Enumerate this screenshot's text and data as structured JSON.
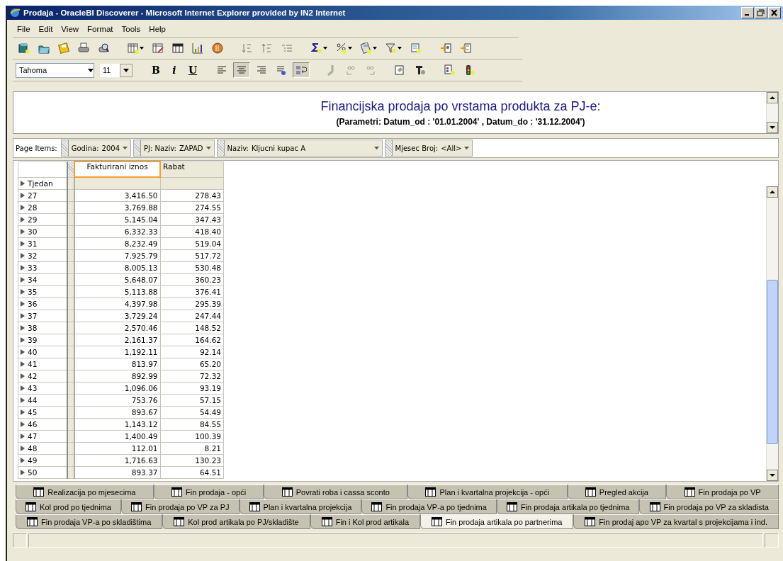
{
  "window": {
    "title": "Prodaja - OracleBI Discoverer - Microsoft Internet Explorer provided by IN2 Internet"
  },
  "menu": [
    "File",
    "Edit",
    "View",
    "Format",
    "Tools",
    "Help"
  ],
  "toolbar": [
    {
      "kind": "workbook",
      "dropdown": false
    },
    {
      "kind": "open",
      "dropdown": false
    },
    {
      "kind": "save",
      "dropdown": false
    },
    {
      "kind": "print",
      "dropdown": false
    },
    {
      "kind": "preview",
      "dropdown": false
    },
    {
      "kind": "newsheet",
      "dropdown": true
    },
    {
      "kind": "editsheet",
      "dropdown": false
    },
    {
      "kind": "table",
      "dropdown": false
    },
    {
      "kind": "chart",
      "dropdown": false
    },
    {
      "kind": "stop",
      "dropdown": false
    },
    {
      "kind": "sortup",
      "dropdown": false
    },
    {
      "kind": "sortdown",
      "dropdown": false
    },
    {
      "kind": "outline",
      "dropdown": false
    },
    {
      "kind": "sum",
      "dropdown": true
    },
    {
      "kind": "percent",
      "dropdown": true
    },
    {
      "kind": "calculate",
      "dropdown": true
    },
    {
      "kind": "filter",
      "dropdown": true
    },
    {
      "kind": "parameter",
      "dropdown": false
    },
    {
      "kind": "import",
      "dropdown": false
    },
    {
      "kind": "export",
      "dropdown": false
    }
  ],
  "format_bar": {
    "font": "Tahoma",
    "size": "11",
    "styles": [
      {
        "kind": "bold",
        "label": "B"
      },
      {
        "kind": "italic",
        "label": "i"
      },
      {
        "kind": "underline",
        "label": "U"
      }
    ],
    "buttons": [
      {
        "kind": "alignleft",
        "selected": false
      },
      {
        "kind": "aligncenter",
        "selected": true
      },
      {
        "kind": "alignright",
        "selected": false
      },
      {
        "kind": "fill",
        "selected": false
      },
      {
        "kind": "wrap",
        "selected": true
      },
      {
        "kind": "comma",
        "selected": false
      },
      {
        "kind": "decimalmore",
        "selected": false
      },
      {
        "kind": "decimalless",
        "selected": false
      },
      {
        "kind": "format",
        "selected": false
      },
      {
        "kind": "textformat",
        "selected": false
      },
      {
        "kind": "conditional",
        "selected": false
      },
      {
        "kind": "stoplight",
        "selected": false
      }
    ]
  },
  "report": {
    "title": "Financijska prodaja po vrstama produkta za PJ-e:",
    "subtitle": "(Parametri: Datum_od : '01.01.2004' , Datum_do : '31.12.2004')"
  },
  "page_items": {
    "label": "Page Items:",
    "items": [
      {
        "label": "Godina:",
        "value": "2004"
      },
      {
        "label": "PJ: Naziv:",
        "value": "ZAPAD"
      },
      {
        "label": "Naziv:",
        "value": "Kljucni kupac A"
      },
      {
        "label": "Mjesec Broj:",
        "value": "<All>"
      }
    ]
  },
  "table": {
    "columns": [
      {
        "label": "Fakturirani iznos",
        "selected": true
      },
      {
        "label": "Rabat",
        "selected": false
      }
    ],
    "row_header": "Tjedan",
    "rows": [
      {
        "week": "27",
        "values": [
          "3,416.50",
          "278.43"
        ]
      },
      {
        "week": "28",
        "values": [
          "3,769.88",
          "274.55"
        ]
      },
      {
        "week": "29",
        "values": [
          "5,145.04",
          "347.43"
        ]
      },
      {
        "week": "30",
        "values": [
          "6,332.33",
          "418.40"
        ]
      },
      {
        "week": "31",
        "values": [
          "8,232.49",
          "519.04"
        ]
      },
      {
        "week": "32",
        "values": [
          "7,925.79",
          "517.72"
        ]
      },
      {
        "week": "33",
        "values": [
          "8,005.13",
          "530.48"
        ]
      },
      {
        "week": "34",
        "values": [
          "5,648.07",
          "360.23"
        ]
      },
      {
        "week": "35",
        "values": [
          "5,113.88",
          "376.41"
        ]
      },
      {
        "week": "36",
        "values": [
          "4,397.98",
          "295.39"
        ]
      },
      {
        "week": "37",
        "values": [
          "3,729.24",
          "247.44"
        ]
      },
      {
        "week": "38",
        "values": [
          "2,570.46",
          "148.52"
        ]
      },
      {
        "week": "39",
        "values": [
          "2,161.37",
          "164.62"
        ]
      },
      {
        "week": "40",
        "values": [
          "1,192.11",
          "92.14"
        ]
      },
      {
        "week": "41",
        "values": [
          "813.97",
          "65.20"
        ]
      },
      {
        "week": "42",
        "values": [
          "892.99",
          "72.32"
        ]
      },
      {
        "week": "43",
        "values": [
          "1,096.06",
          "93.19"
        ]
      },
      {
        "week": "44",
        "values": [
          "753.76",
          "57.15"
        ]
      },
      {
        "week": "45",
        "values": [
          "893.67",
          "54.49"
        ]
      },
      {
        "week": "46",
        "values": [
          "1,143.12",
          "84.55"
        ]
      },
      {
        "week": "47",
        "values": [
          "1,400.49",
          "100.39"
        ]
      },
      {
        "week": "48",
        "values": [
          "112.01",
          "8.21"
        ]
      },
      {
        "week": "49",
        "values": [
          "1,716.63",
          "130.23"
        ]
      },
      {
        "week": "50",
        "values": [
          "893.37",
          "64.51"
        ]
      }
    ]
  },
  "sheet_tabs": [
    [
      {
        "label": "Realizacija po mjesecima",
        "selected": false
      },
      {
        "label": "Fin prodaja - opći",
        "selected": false
      },
      {
        "label": "Povrati roba i cassa sconto",
        "selected": false
      },
      {
        "label": "Plan i kvartalna projekcija - opći",
        "selected": false
      },
      {
        "label": "Pregled akcija",
        "selected": false
      },
      {
        "label": "Fin prodaja po VP",
        "selected": false
      }
    ],
    [
      {
        "label": "Kol prod po tjednima",
        "selected": false
      },
      {
        "label": "Fin prodaja po VP za PJ",
        "selected": false
      },
      {
        "label": "Plan i kvartalna projekcija",
        "selected": false
      },
      {
        "label": "Fin prodaja VP-a po tjednima",
        "selected": false
      },
      {
        "label": "Fin prodaja artikala po tjednima",
        "selected": false
      },
      {
        "label": "Fin prodaja po VP za skladista",
        "selected": false
      }
    ],
    [
      {
        "label": "Fin prodaja VP-a po skladištima",
        "selected": false
      },
      {
        "label": "Kol prod artikala po PJ/skladište",
        "selected": false
      },
      {
        "label": "Fin i Kol prod artikala",
        "selected": false
      },
      {
        "label": "Fin prodaja artikala po partnerima",
        "selected": true
      },
      {
        "label": "Fin prodaj apo VP za kvartal s projekcijama i ind.",
        "selected": false
      }
    ]
  ]
}
